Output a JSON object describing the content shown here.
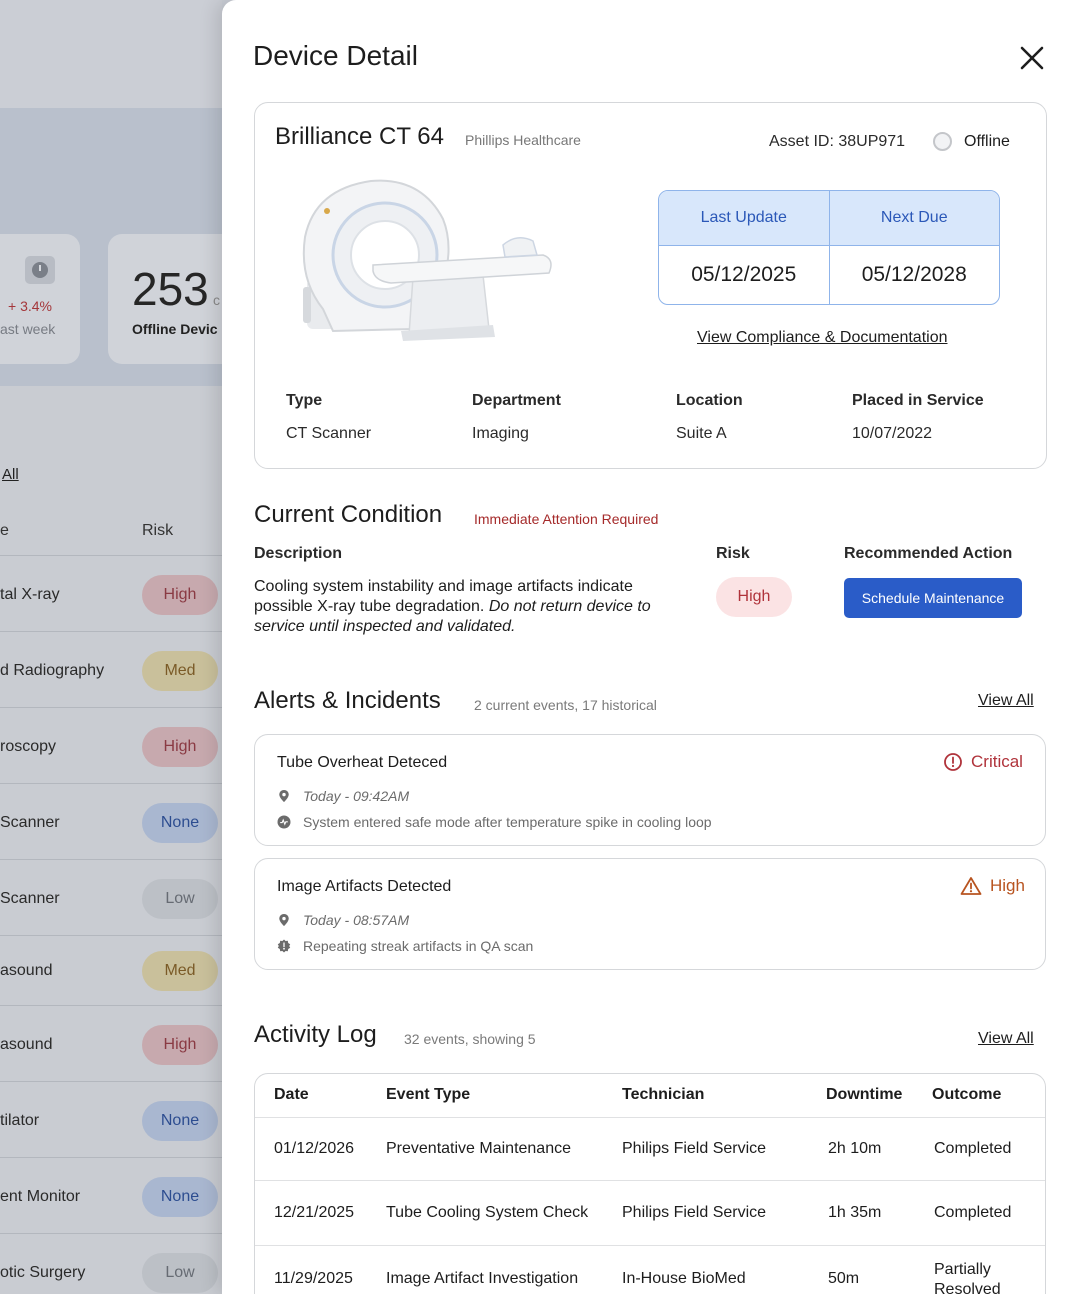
{
  "background": {
    "trend_value": "+ 3.4%",
    "trend_sub": "ast week",
    "offline_count": "253",
    "offline_count_suffix": "c",
    "offline_label": "Offline Devic",
    "view_all": "All",
    "col_name": "e",
    "col_risk": "Risk",
    "rows": [
      {
        "name": "tal X-ray",
        "risk": "High"
      },
      {
        "name": "d Radiography",
        "risk": "Med"
      },
      {
        "name": "roscopy",
        "risk": "High"
      },
      {
        "name": "Scanner",
        "risk": "None"
      },
      {
        "name": "Scanner",
        "risk": "Low"
      },
      {
        "name": "asound",
        "risk": "Med"
      },
      {
        "name": "asound",
        "risk": "High"
      },
      {
        "name": "tilator",
        "risk": "None"
      },
      {
        "name": "ent Monitor",
        "risk": "None"
      },
      {
        "name": "otic Surgery",
        "risk": "Low"
      }
    ]
  },
  "panel": {
    "title": "Device Detail"
  },
  "device": {
    "name": "Brilliance CT 64",
    "manufacturer": "Phillips Healthcare",
    "asset_id": "Asset ID: 38UP971",
    "status": "Offline",
    "last_update_label": "Last Update",
    "last_update": "05/12/2025",
    "next_due_label": "Next Due",
    "next_due": "05/12/2028",
    "compliance_link": "View Compliance & Documentation",
    "meta": [
      {
        "key": "Type",
        "value": "CT Scanner"
      },
      {
        "key": "Department",
        "value": "Imaging"
      },
      {
        "key": "Location",
        "value": "Suite A"
      },
      {
        "key": "Placed in Service",
        "value": "10/07/2022"
      }
    ]
  },
  "condition": {
    "title": "Current Condition",
    "badge": "Immediate Attention Required",
    "description_label": "Description",
    "risk_label": "Risk",
    "action_label": "Recommended Action",
    "description": "Cooling system instability and image artifacts indicate possible X-ray tube degradation.",
    "description_italic": "Do not return device to service until inspected and validated.",
    "risk": "High",
    "action_button": "Schedule Maintenance"
  },
  "alerts": {
    "title": "Alerts & Incidents",
    "summary": "2 current events, 17 historical",
    "view_all": "View All",
    "items": [
      {
        "title": "Tube Overheat Deteced",
        "severity": "Critical",
        "time": "Today - 09:42AM",
        "detail": "System entered safe mode after temperature spike in cooling loop"
      },
      {
        "title": "Image Artifacts Detected",
        "severity": "High",
        "time": "Today - 08:57AM",
        "detail": "Repeating streak artifacts in QA scan"
      }
    ]
  },
  "activity": {
    "title": "Activity Log",
    "summary": "32 events, showing 5",
    "view_all": "View All",
    "columns": [
      "Date",
      "Event Type",
      "Technician",
      "Downtime",
      "Outcome"
    ],
    "rows": [
      {
        "date": "01/12/2026",
        "event": "Preventative Maintenance",
        "tech": "Philips Field Service",
        "downtime": "2h 10m",
        "outcome": "Completed"
      },
      {
        "date": "12/21/2025",
        "event": "Tube Cooling System Check",
        "tech": "Philips Field Service",
        "downtime": "1h 35m",
        "outcome": "Completed"
      },
      {
        "date": "11/29/2025",
        "event": "Image Artifact Investigation",
        "tech": "In-House BioMed",
        "downtime": "50m",
        "outcome": "Partially Resolved"
      }
    ]
  },
  "colors": {
    "accent": "#2a5cc8",
    "critical": "#b0333b",
    "high_warning": "#b85420",
    "date_header_bg": "#d8e7fb"
  }
}
